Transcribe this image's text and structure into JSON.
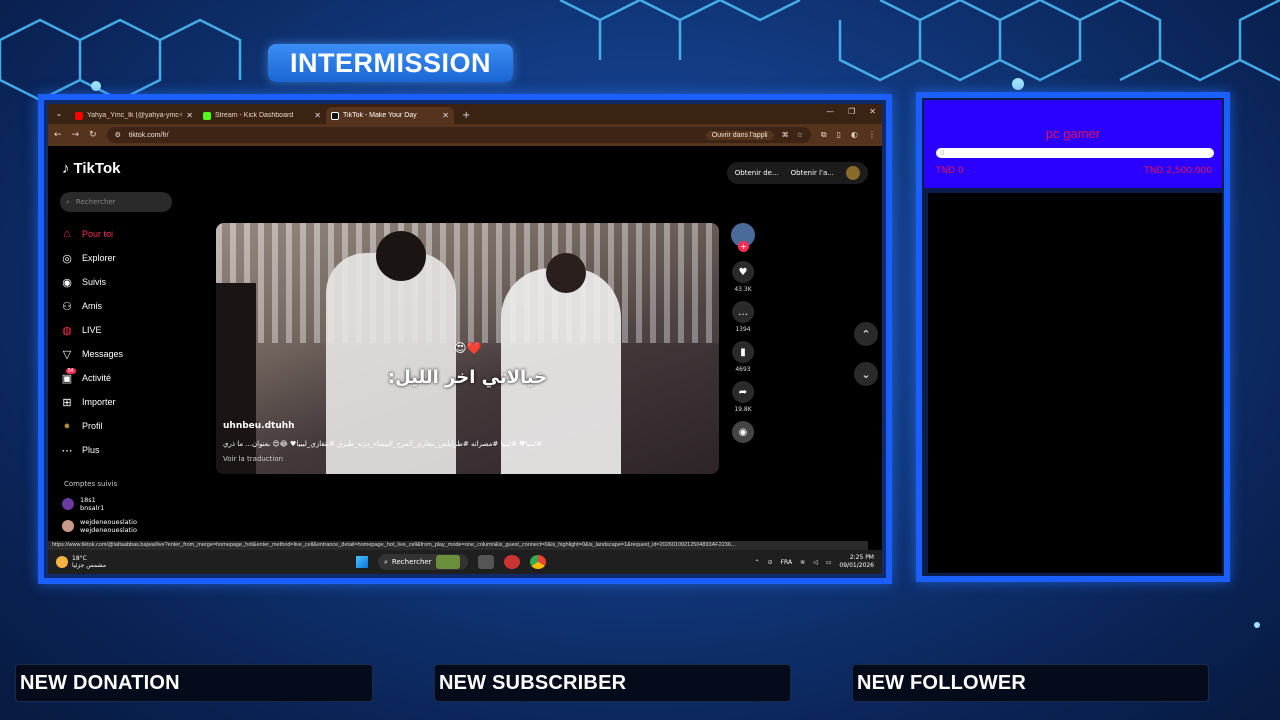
{
  "overlay": {
    "intermission_label": "INTERMISSION",
    "alerts": {
      "donation": "NEW DONATION",
      "subscriber": "NEW SUBSCRIBER",
      "follower": "NEW FOLLOWER"
    },
    "goal": {
      "title": "pc gamer",
      "bar_value": "0",
      "left_label": "TND 0",
      "right_label": "TND 2,500.000"
    },
    "colors": {
      "frame_border": "#1b5fff",
      "goal_bg": "#2a00ff",
      "goal_text": "#e0105a"
    }
  },
  "browser": {
    "tabs": [
      {
        "title": "Yahya_Ymc_tk (@yahya-ymc-tk",
        "icon": "youtube-icon",
        "color": "#ff0000",
        "active": false
      },
      {
        "title": "Stream - Kick Dashboard",
        "icon": "kick-icon",
        "color": "#53fc18",
        "active": false
      },
      {
        "title": "TikTok - Make Your Day",
        "icon": "tiktok-icon",
        "color": "#ffffff",
        "active": true
      }
    ],
    "url": "tiktok.com/fr/",
    "open_app_label": "Ouvrir dans l'appli",
    "status_url": "https://www.tiktok.com/@taltaabbas.bajwa/live?enter_from_merge=homepage_hot&enter_method=live_cell&entrance_detail=homepage_hot_live_cell&from_play_mode=one_column&is_guest_connect=0&is_highlight=0&is_landscape=1&request_id=20260109212504893AF2236..."
  },
  "tiktok": {
    "logo": "TikTok",
    "search_placeholder": "Rechercher",
    "top_buttons": [
      "Obtenir de...",
      "Obtenir l'a..."
    ],
    "nav": [
      {
        "label": "Pour toi",
        "icon": "home-icon",
        "glyph": "⌂"
      },
      {
        "label": "Explorer",
        "icon": "compass-icon",
        "glyph": "◎"
      },
      {
        "label": "Suivis",
        "icon": "following-icon",
        "glyph": "◉"
      },
      {
        "label": "Amis",
        "icon": "friends-icon",
        "glyph": "⚇"
      },
      {
        "label": "LIVE",
        "icon": "live-icon",
        "glyph": "◍"
      },
      {
        "label": "Messages",
        "icon": "messages-icon",
        "glyph": "▽"
      },
      {
        "label": "Activité",
        "icon": "activity-icon",
        "glyph": "▣",
        "badge": "54"
      },
      {
        "label": "Importer",
        "icon": "upload-icon",
        "glyph": "⊞"
      },
      {
        "label": "Profil",
        "icon": "profile-icon",
        "glyph": "●"
      },
      {
        "label": "Plus",
        "icon": "more-icon",
        "glyph": "⋯"
      }
    ],
    "following_title": "Comptes suivis",
    "following": [
      {
        "name": "18s1",
        "handle": "bnsalr1"
      },
      {
        "name": "wejdeneoueslatio",
        "handle": "wejdeneoueslatio"
      }
    ],
    "video": {
      "emoji": "😍❤️",
      "caption": "خيالاتي اخر الليل:",
      "author": "uhnbeu.dtuhh",
      "tags": "#ليبيا♥ #ليبيا #مصراته #طرابلس_بنغازي_المرج_البيضاء_درنه_طبرق #بنغازي_ليبيا♥ 😂😍 بعنوان... ما ذري",
      "translate": "Voir la traduction"
    },
    "actions": [
      {
        "icon": "heart-icon",
        "glyph": "♥",
        "count": "43.3K"
      },
      {
        "icon": "comment-icon",
        "glyph": "…",
        "count": "1394"
      },
      {
        "icon": "bookmark-icon",
        "glyph": "▮",
        "count": "4693"
      },
      {
        "icon": "share-icon",
        "glyph": "➦",
        "count": "19.8K"
      }
    ]
  },
  "taskbar": {
    "temp": "18°C",
    "weather_text": "مشمس جزئيا",
    "search_label": "Rechercher",
    "lang": "FRA",
    "time": "2:25 PM",
    "date": "09/01/2026"
  }
}
